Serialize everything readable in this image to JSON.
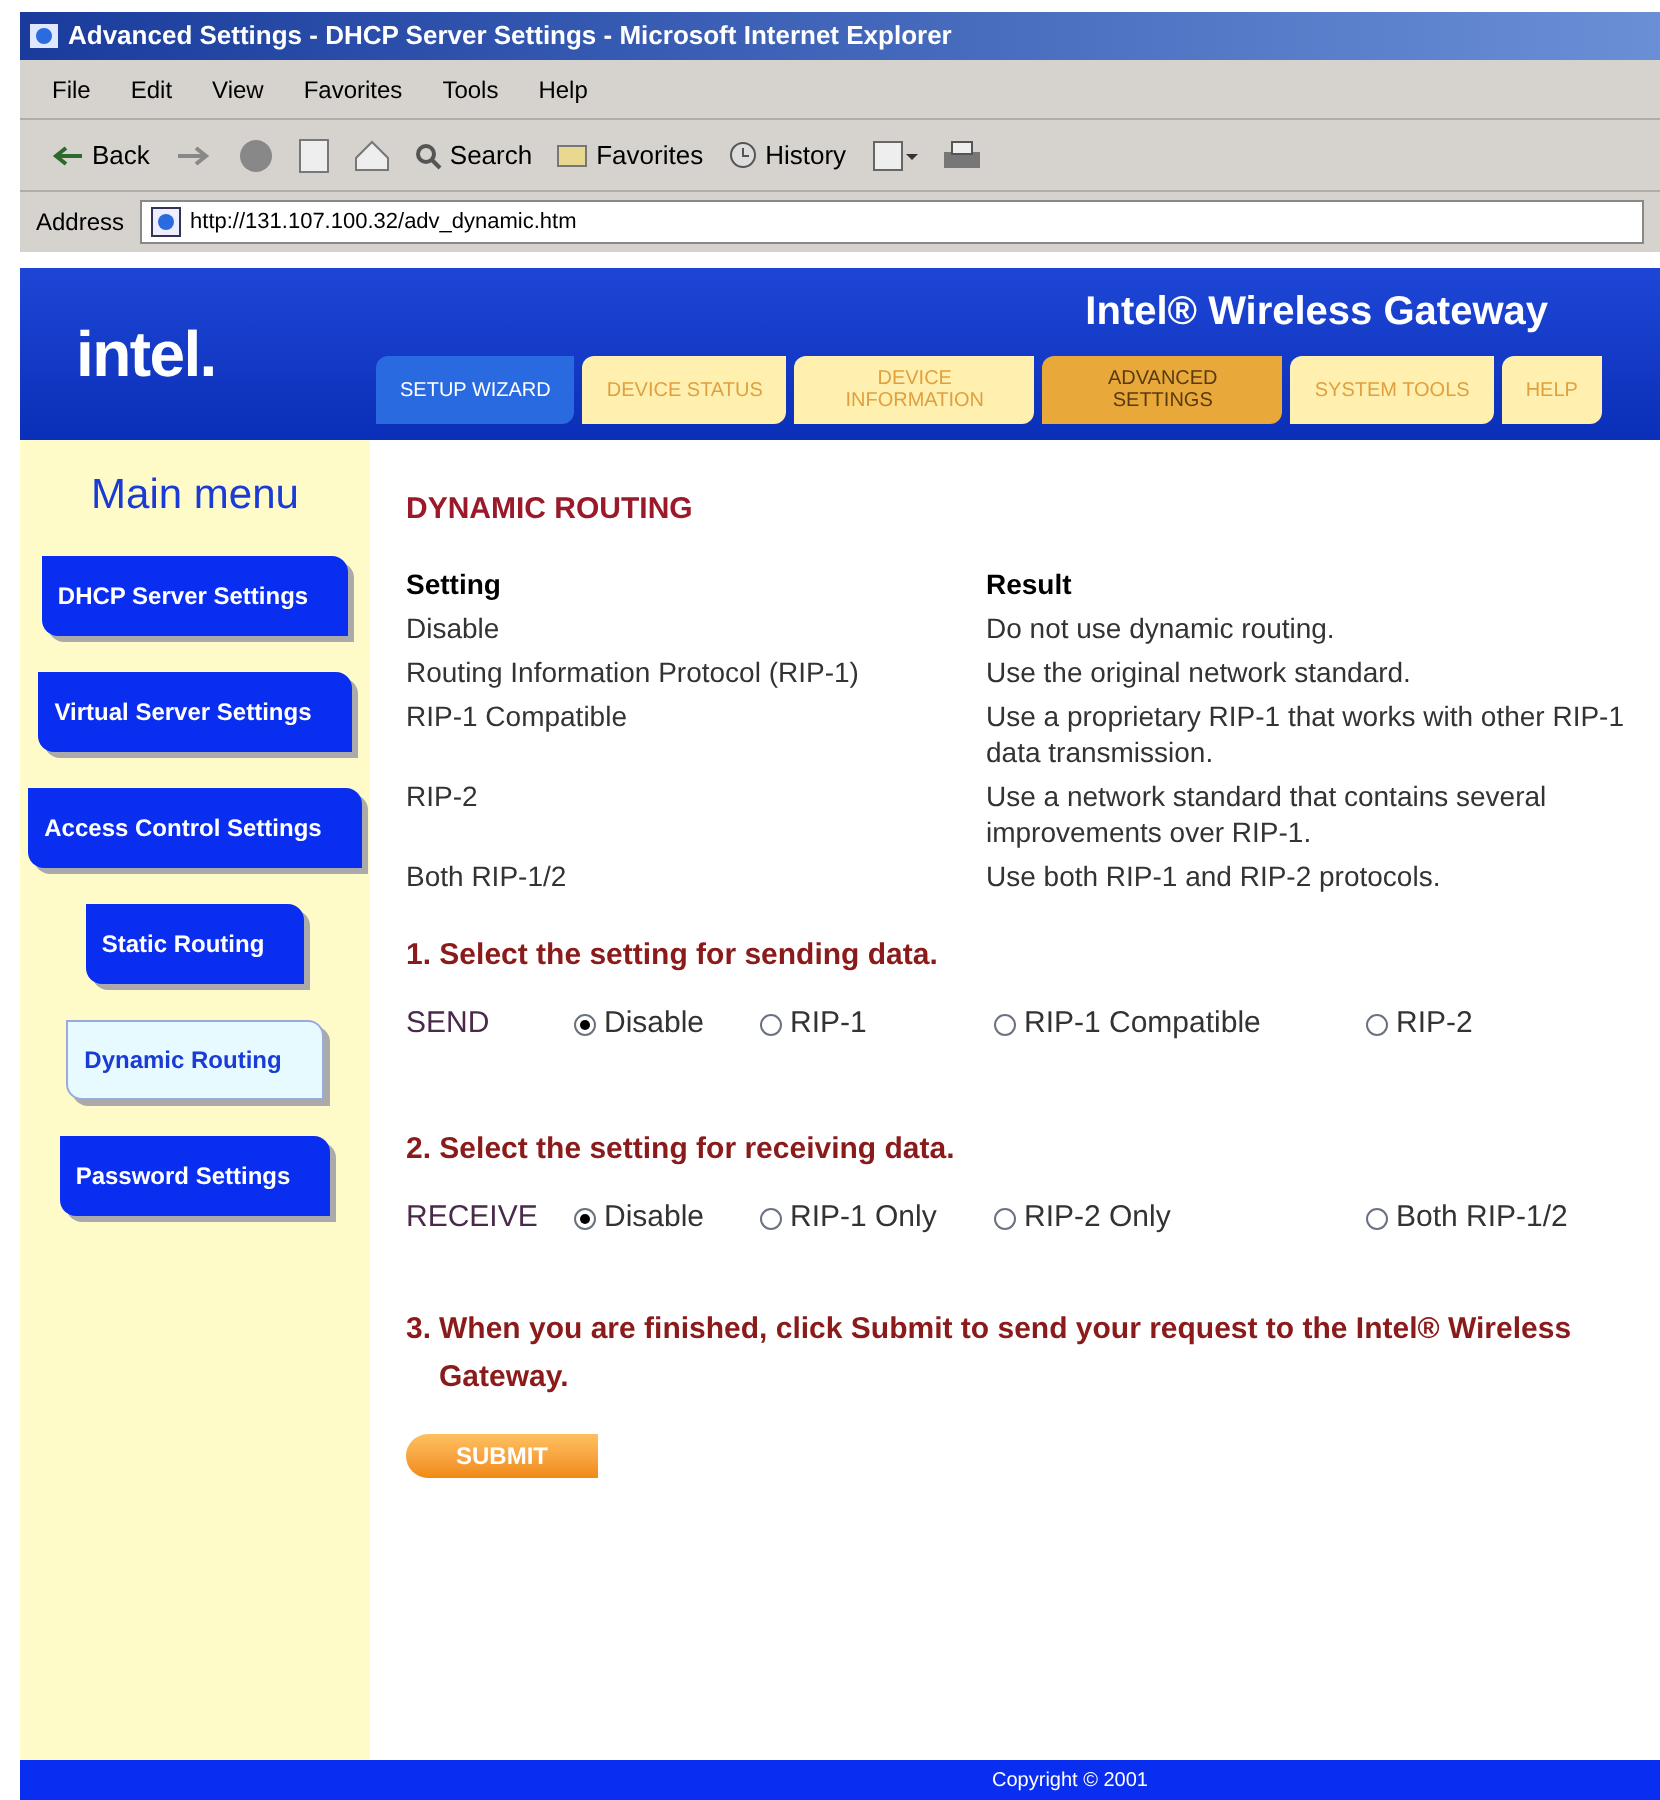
{
  "window": {
    "title": "Advanced Settings - DHCP Server Settings - Microsoft Internet Explorer"
  },
  "menu": [
    "File",
    "Edit",
    "View",
    "Favorites",
    "Tools",
    "Help"
  ],
  "toolbar": {
    "back": "Back",
    "search": "Search",
    "favorites": "Favorites",
    "history": "History"
  },
  "address": {
    "label": "Address",
    "value": "http://131.107.100.32/adv_dynamic.htm"
  },
  "header": {
    "logo": "intel.",
    "title": "Intel® Wireless Gateway"
  },
  "tabs": [
    {
      "label": "SETUP WIZARD",
      "kind": "wizard",
      "selected": false
    },
    {
      "label": "DEVICE STATUS",
      "kind": "tab",
      "selected": false
    },
    {
      "label": "DEVICE INFORMATION",
      "kind": "tab",
      "selected": false
    },
    {
      "label": "ADVANCED SETTINGS",
      "kind": "tab",
      "selected": true
    },
    {
      "label": "SYSTEM TOOLS",
      "kind": "tab",
      "selected": false
    },
    {
      "label": "HELP",
      "kind": "tab",
      "selected": false
    }
  ],
  "sidebar": {
    "title": "Main menu",
    "items": [
      {
        "label": "DHCP Server Settings",
        "selected": false
      },
      {
        "label": "Virtual Server Settings",
        "selected": false
      },
      {
        "label": "Access Control Settings",
        "selected": false
      },
      {
        "label": "Static Routing",
        "selected": false
      },
      {
        "label": "Dynamic Routing",
        "selected": true
      },
      {
        "label": "Password Settings",
        "selected": false
      }
    ]
  },
  "heading": "DYNAMIC ROUTING",
  "table": {
    "columns": [
      "Setting",
      "Result"
    ],
    "rows": [
      [
        "Disable",
        "Do not use dynamic routing."
      ],
      [
        "Routing Information Protocol (RIP-1)",
        "Use the original network standard."
      ],
      [
        "RIP-1 Compatible",
        "Use a proprietary RIP-1 that works with other RIP-1 data transmission."
      ],
      [
        "RIP-2",
        "Use a network standard that contains several improvements over RIP-1."
      ],
      [
        "Both RIP-1/2",
        "Use both RIP-1 and RIP-2 protocols."
      ]
    ]
  },
  "send": {
    "step": "1. Select the setting for sending data.",
    "label": "SEND",
    "options": [
      {
        "label": "Disable",
        "selected": true
      },
      {
        "label": "RIP-1",
        "selected": false
      },
      {
        "label": "RIP-1 Compatible",
        "selected": false
      },
      {
        "label": "RIP-2",
        "selected": false
      }
    ]
  },
  "receive": {
    "step": "2. Select the setting for receiving data.",
    "label": "RECEIVE",
    "options": [
      {
        "label": "Disable",
        "selected": true
      },
      {
        "label": "RIP-1 Only",
        "selected": false
      },
      {
        "label": "RIP-2 Only",
        "selected": false
      },
      {
        "label": "Both RIP-1/2",
        "selected": false
      }
    ]
  },
  "finish": {
    "step": "3.",
    "text": "When you are finished, click Submit to send your request to the Intel® Wireless Gateway.",
    "button": "SUBMIT"
  },
  "footer": "Copyright © 2001"
}
